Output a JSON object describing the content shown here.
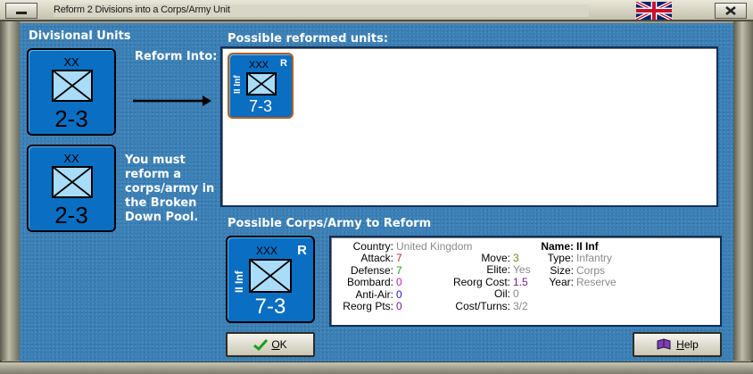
{
  "window": {
    "title": "Reform 2 Divisions into a Corps/Army Unit",
    "close_icon": "close-icon"
  },
  "divisional": {
    "heading": "Divisional Units",
    "units": [
      {
        "echelon": "XX",
        "strength": "2-3"
      },
      {
        "echelon": "XX",
        "strength": "2-3"
      }
    ]
  },
  "reform_into_label": "Reform Into:",
  "note": "You must reform a corps/army in the Broken Down Pool.",
  "possible_reformed": {
    "heading": "Possible reformed units:",
    "units": [
      {
        "name": "II Inf",
        "echelon": "XXX",
        "badge": "R",
        "strength": "7-3"
      }
    ]
  },
  "corps_section": {
    "heading": "Possible Corps/Army to Reform",
    "counter": {
      "name": "II Inf",
      "echelon": "XXX",
      "badge": "R",
      "strength": "7-3"
    },
    "info": {
      "col1": [
        {
          "label": "Country:",
          "value": "United Kingdom",
          "color": "#8a8a8a"
        },
        {
          "label": "Attack:",
          "value": "7",
          "color": "#d02020"
        },
        {
          "label": "Defense:",
          "value": "7",
          "color": "#1f9b1f"
        },
        {
          "label": "Bombard:",
          "value": "0",
          "color": "#c020c0"
        },
        {
          "label": "Anti-Air:",
          "value": "0",
          "color": "#1a1acc"
        },
        {
          "label": "Reorg Pts:",
          "value": "0",
          "color": "#7a1a8a"
        }
      ],
      "col2": [
        {
          "label": "Move:",
          "value": "3",
          "color": "#6a8a10"
        },
        {
          "label": "Elite:",
          "value": "Yes",
          "color": "#8a8a8a"
        },
        {
          "label": "Reorg Cost:",
          "value": "1.5",
          "color": "#7a1a8a"
        },
        {
          "label": "Oil:",
          "value": "0",
          "color": "#8a8a8a"
        },
        {
          "label": "Cost/Turns:",
          "value": "3/2",
          "color": "#8a8a8a"
        }
      ],
      "col3": [
        {
          "label": "Name:",
          "value": "II Inf",
          "color": "#000000",
          "bold": true
        },
        {
          "label": "Type:",
          "value": "Infantry",
          "color": "#8a8a8a"
        },
        {
          "label": "Size:",
          "value": "Corps",
          "color": "#8a8a8a"
        },
        {
          "label": "Year:",
          "value": "Reserve",
          "color": "#8a8a8a"
        }
      ]
    }
  },
  "buttons": {
    "ok_prefix": "",
    "ok_underlined": "O",
    "ok_rest": "K",
    "help_underlined": "H",
    "help_rest": "elp"
  }
}
